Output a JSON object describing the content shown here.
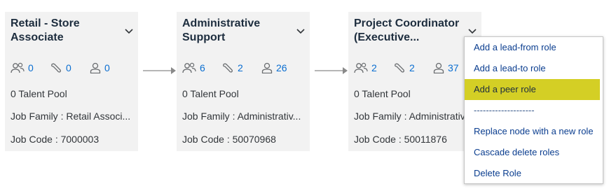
{
  "cards": [
    {
      "title": "Retail - Store Associate",
      "stats": {
        "reports": "0",
        "skills": "0",
        "people": "0"
      },
      "talent_pool": "0 Talent Pool",
      "job_family": "Job Family : Retail Associ...",
      "job_code": "Job Code : 7000003"
    },
    {
      "title": "Administrative Support",
      "stats": {
        "reports": "6",
        "skills": "2",
        "people": "26"
      },
      "talent_pool": "0 Talent Pool",
      "job_family": "Job Family : Administrativ...",
      "job_code": "Job Code : 50070968"
    },
    {
      "title": "Project Coordinator (Executive...",
      "stats": {
        "reports": "2",
        "skills": "2",
        "people": "37"
      },
      "talent_pool": "0 Talent Pool",
      "job_family": "Job Family : Administrative",
      "job_code": "Job Code : 50011876"
    }
  ],
  "menu": {
    "items": [
      "Add a lead-from role",
      "Add a lead-to role",
      "Add a peer role",
      "--------------------",
      "Replace node with a new role",
      "Cascade delete roles",
      "Delete Role"
    ],
    "highlighted_index": 2
  },
  "colors": {
    "card_bg": "#f2f2f2",
    "link": "#0a6ed1",
    "highlight": "#d4cf25",
    "arrow": "#8a8a8a"
  },
  "icons": [
    "group-icon",
    "wrench-icon",
    "person-icon",
    "chevron-down-icon",
    "arrow-right-icon"
  ]
}
